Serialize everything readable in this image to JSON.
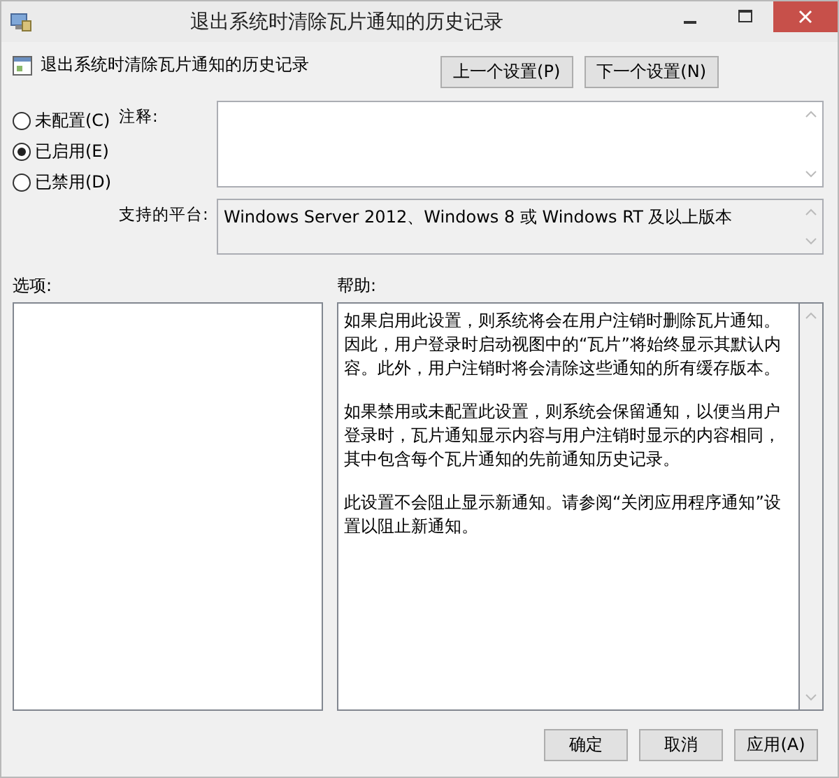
{
  "window": {
    "title": "退出系统时清除瓦片通知的历史记录"
  },
  "setting_name": "退出系统时清除瓦片通知的历史记录",
  "nav_buttons": [
    "上一个设置(P)",
    "下一个设置(N)"
  ],
  "options": [
    {
      "label": "未配置(C)",
      "selected": false
    },
    {
      "label": "已启用(E)",
      "selected": true
    },
    {
      "label": "已禁用(D)",
      "selected": false
    }
  ],
  "comment": {
    "label": "注释:"
  },
  "platform": {
    "label": "支持的平台:",
    "value": "Windows Server 2012、Windows 8 或 Windows RT 及以上版本"
  },
  "options_label": "选项:",
  "help": {
    "label": "帮助:",
    "paragraphs": [
      "如果启用此设置，则系统将会在用户注销时删除瓦片通知。因此，用户登录时启动视图中的“瓦片”将始终显示其默认内容。此外，用户注销时将会清除这些通知的所有缓存版本。",
      "如果禁用或未配置此设置，则系统会保留通知，以便当用户登录时，瓦片通知显示内容与用户注销时显示的内容相同，其中包含每个瓦片通知的先前通知历史记录。",
      "此设置不会阻止显示新通知。请参阅“关闭应用程序通知”设置以阻止新通知。"
    ]
  },
  "buttons": [
    "确定",
    "取消",
    "应用(A)"
  ]
}
